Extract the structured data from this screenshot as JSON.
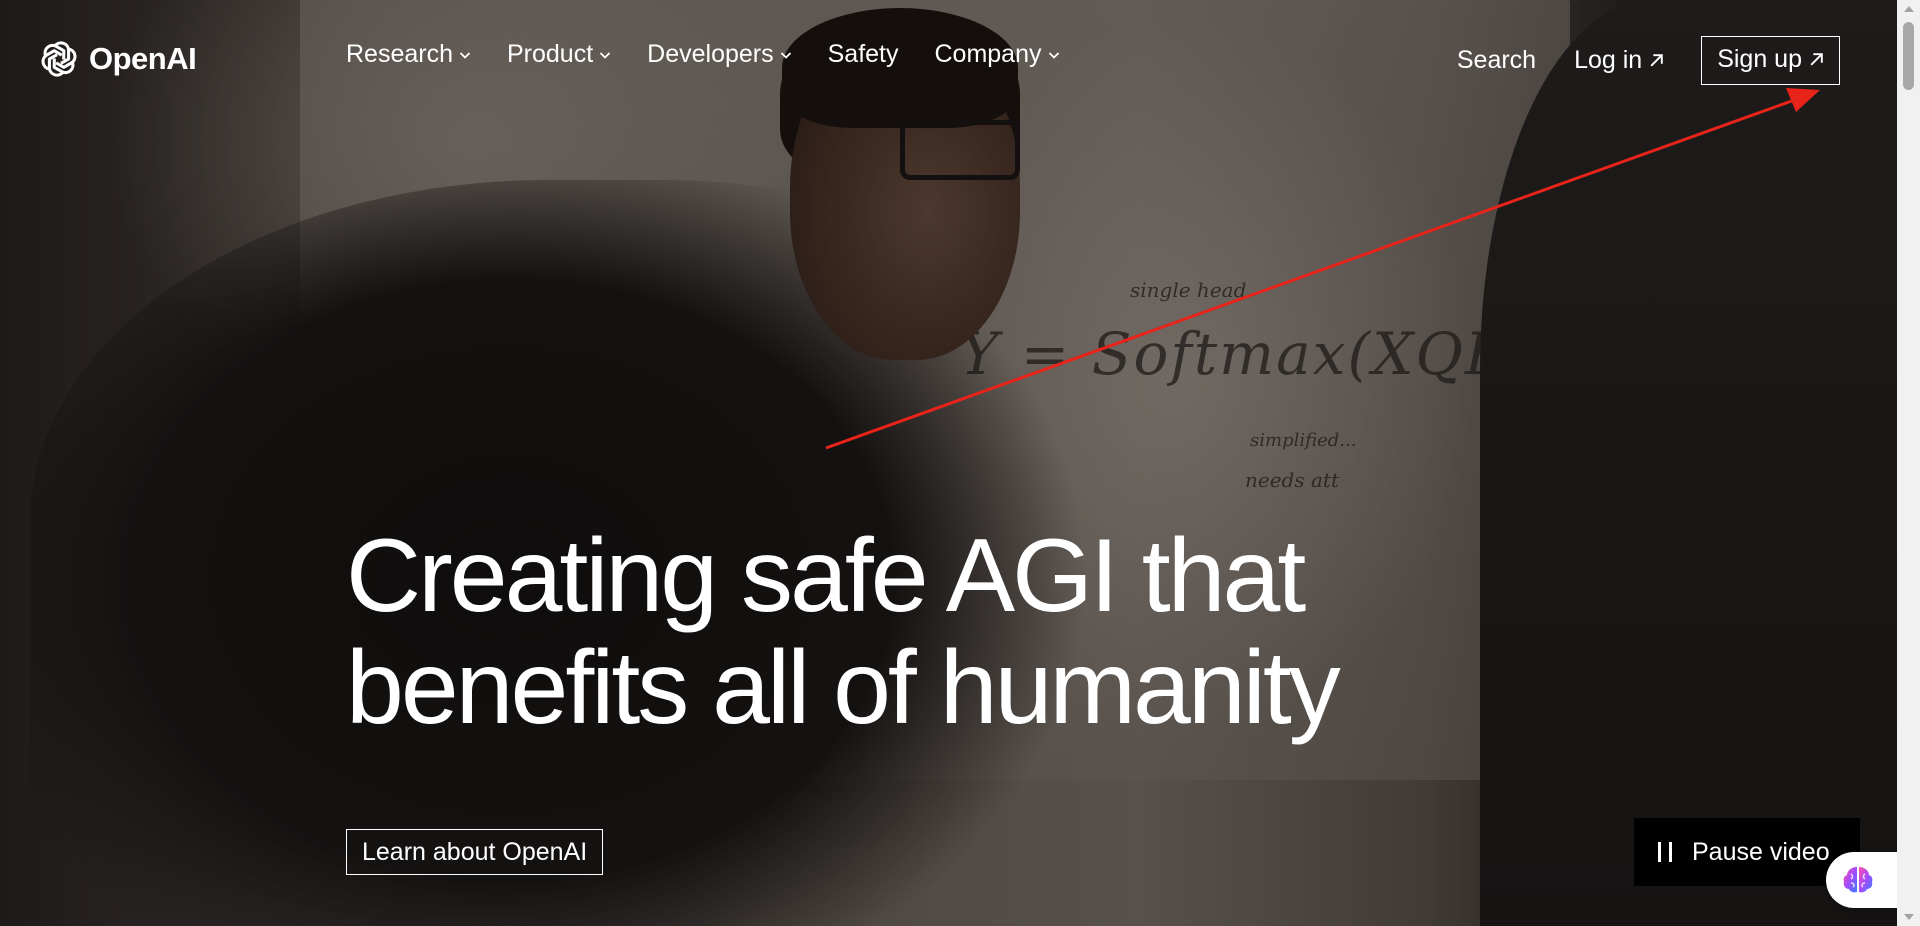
{
  "brand": {
    "name": "OpenAI",
    "logo_icon": "openai-logo-icon"
  },
  "nav": {
    "items": [
      {
        "label": "Research",
        "has_dropdown": true
      },
      {
        "label": "Product",
        "has_dropdown": true
      },
      {
        "label": "Developers",
        "has_dropdown": true
      },
      {
        "label": "Safety",
        "has_dropdown": false
      },
      {
        "label": "Company",
        "has_dropdown": true
      }
    ],
    "search_label": "Search",
    "login_label": "Log in",
    "signup_label": "Sign up",
    "external_icon": "arrow-up-right-icon",
    "dropdown_icon": "chevron-down-icon"
  },
  "hero": {
    "headline_line1": "Creating safe AGI that",
    "headline_line2": "benefits all of humanity",
    "cta_label": "Learn about OpenAI"
  },
  "video": {
    "pause_label": "Pause video",
    "pause_icon": "pause-icon"
  },
  "whiteboard": {
    "equation": "Y = Softmax(XQKᵀXᵀ)XV",
    "note_top": "single head",
    "note_mid": "simplified...",
    "note_bottom": "needs att"
  },
  "assistant": {
    "icon": "brain-icon"
  },
  "colors": {
    "text": "#ffffff",
    "annotation_arrow": "#e8231a",
    "pause_bg": "#000000"
  }
}
